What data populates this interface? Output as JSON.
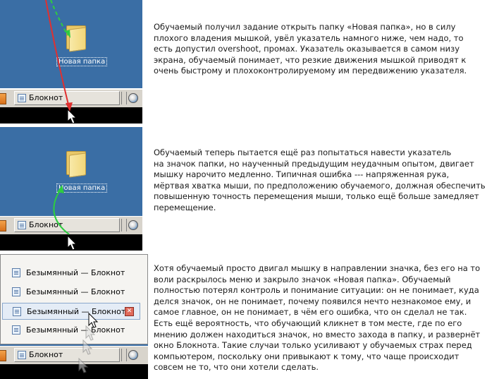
{
  "panel1": {
    "folder_label": "Новая папка",
    "taskbar_button_label": "Блокнот"
  },
  "panel2": {
    "folder_label": "Новая папка",
    "taskbar_button_label": "Блокнот"
  },
  "panel3": {
    "menu_items": [
      {
        "label": "Безымянный — Блокнот"
      },
      {
        "label": "Безымянный — Блокнот"
      },
      {
        "label": "Безымянный — Блокнот"
      },
      {
        "label": "Безымянный — Блокнот"
      }
    ],
    "taskbar_button_label": "Блокнот"
  },
  "texts": {
    "para1_lines": [
      "Обучаемый получил задание открыть папку «Новая папка», но в силу",
      "плохого владения мышкой, увёл указатель намного ниже, чем надо, то",
      "есть допустил overshoot, промах. Указатель оказывается в самом низу",
      "экрана, обучаемый понимает, что резкие движения мышкой приводят к",
      "очень быстрому и плохоконтролируемому им передвижению указателя."
    ],
    "para2_lines": [
      "Обучаемый теперь пытается ещё раз попытаться навести указатель",
      "на значок папки, но наученный предыдущим неудачным опытом, двигает",
      "мышку нарочито медленно. Типичная ошибка --- напряженная рука,",
      "мёртвая хватка мыши, по предположению обучаемого, должная обеспечить",
      "повышенную точность перемещения мыши, только ещё больше замедляет",
      "перемещение."
    ],
    "para3_lines": [
      "Хотя обучаемый просто двигал мышку в направлении значка, без его на то",
      "воли раскрылось меню и закрыло значок «Новая папка». Обучаемый",
      "полностью потерял контроль и понимание ситуации: он не понимает, куда",
      "делся значок, он не понимает, почему появился нечто незнакомое ему, и",
      "самое главное, он не понимает, в чём его ошибка, что он сделал не так.",
      "Есть ещё вероятность, что обучающий кликнет в том месте, где по его",
      "мнению должен находиться значок, но вместо захода в папку, и развернёт",
      "окно Блокнота. Такие случаи только усиливают у обучаемых страх перед",
      "компьютером, поскольку они привыкают к тому, что чаще происходит",
      "совсем не то, что они хотели сделать."
    ]
  },
  "colors": {
    "desktop": "#3a6ea5",
    "taskbar": "#d8d4cc",
    "overshoot_arrow": "#e03030",
    "intended_path": "#2ecc40",
    "slow_path": "#2ecc40"
  }
}
